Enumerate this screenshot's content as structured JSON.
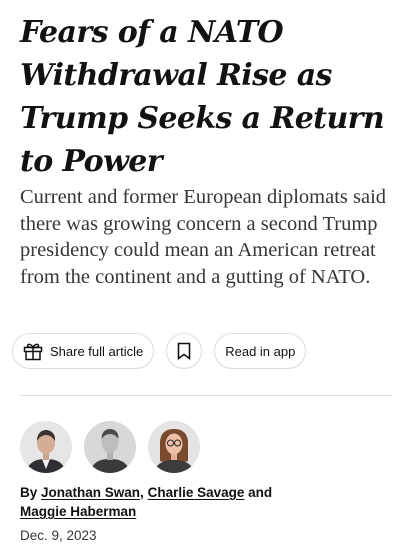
{
  "article": {
    "headline": "Fears of a NATO Withdrawal Rise as Trump Seeks a Return to Power",
    "summary": "Current and former European diplomats said there was growing concern a second Trump presidency could mean an American retreat from the continent and a gutting of NATO."
  },
  "actions": {
    "share_label": "Share full article",
    "save_icon": "bookmark-icon",
    "read_label": "Read in app"
  },
  "byline": {
    "prefix": "By",
    "authors": [
      "Jonathan Swan",
      "Charlie Savage",
      "Maggie Haberman"
    ],
    "separator": ",",
    "and": "and"
  },
  "date": "Dec. 9, 2023"
}
